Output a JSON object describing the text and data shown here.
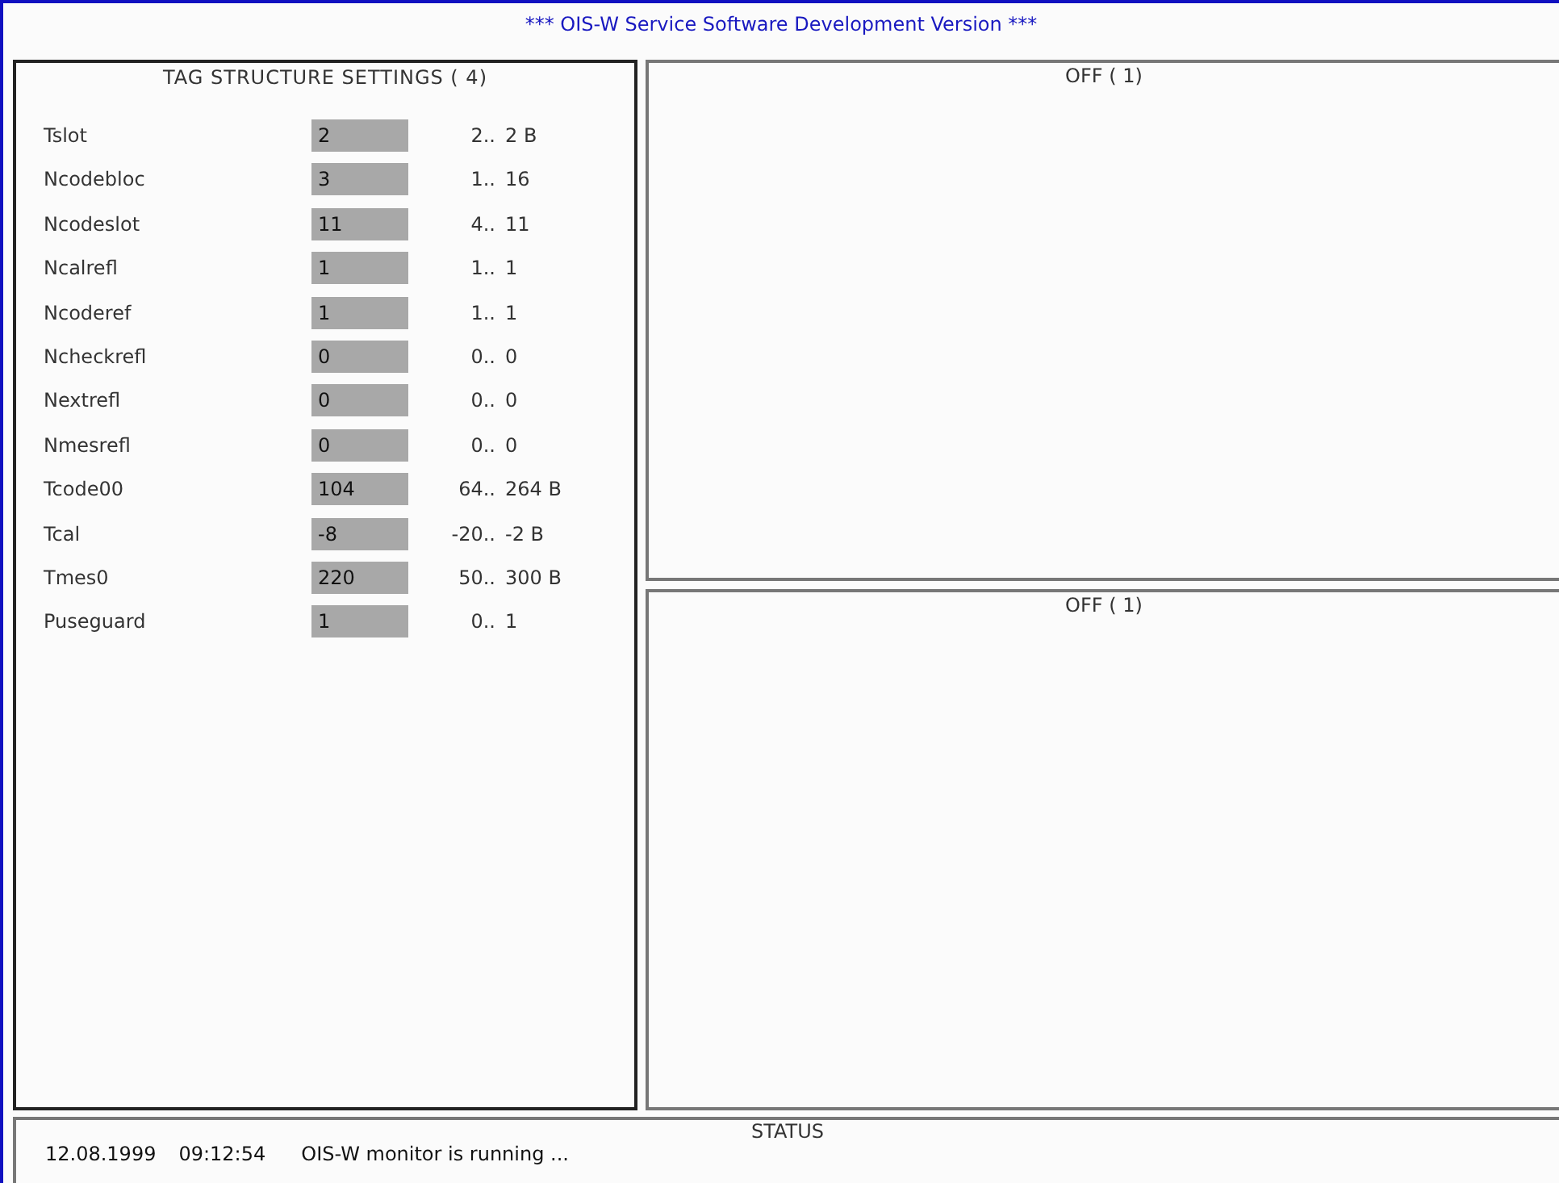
{
  "window": {
    "title": "*** OIS-W Service Software Development Version ***"
  },
  "tag_panel": {
    "title": "TAG STRUCTURE SETTINGS ( 4)",
    "rows": [
      {
        "name": "Tslot",
        "value": "2",
        "min": "2..",
        "max": "2 B"
      },
      {
        "name": "Ncodebloc",
        "value": "3",
        "min": "1..",
        "max": "16"
      },
      {
        "name": "Ncodeslot",
        "value": "11",
        "min": "4..",
        "max": "11"
      },
      {
        "name": "Ncalrefl",
        "value": "1",
        "min": "1..",
        "max": "1"
      },
      {
        "name": "Ncoderef",
        "value": "1",
        "min": "1..",
        "max": "1"
      },
      {
        "name": "Ncheckrefl",
        "value": "0",
        "min": "0..",
        "max": "0"
      },
      {
        "name": "Nextrefl",
        "value": "0",
        "min": "0..",
        "max": "0"
      },
      {
        "name": "Nmesrefl",
        "value": "0",
        "min": "0..",
        "max": "0"
      },
      {
        "name": "Tcode00",
        "value": "104",
        "min": "64..",
        "max": "264 B"
      },
      {
        "name": "Tcal",
        "value": "-8",
        "min": "-20..",
        "max": "-2 B"
      },
      {
        "name": "Tmes0",
        "value": "220",
        "min": "50..",
        "max": "300 B"
      },
      {
        "name": "Puseguard",
        "value": "1",
        "min": "0..",
        "max": "1"
      }
    ]
  },
  "right_panels": [
    {
      "title": "OFF ( 1)"
    },
    {
      "title": "OFF ( 1)"
    }
  ],
  "status": {
    "title": "STATUS",
    "date": "12.08.1999",
    "time": "09:12:54",
    "message": "OIS-W monitor is running ..."
  }
}
